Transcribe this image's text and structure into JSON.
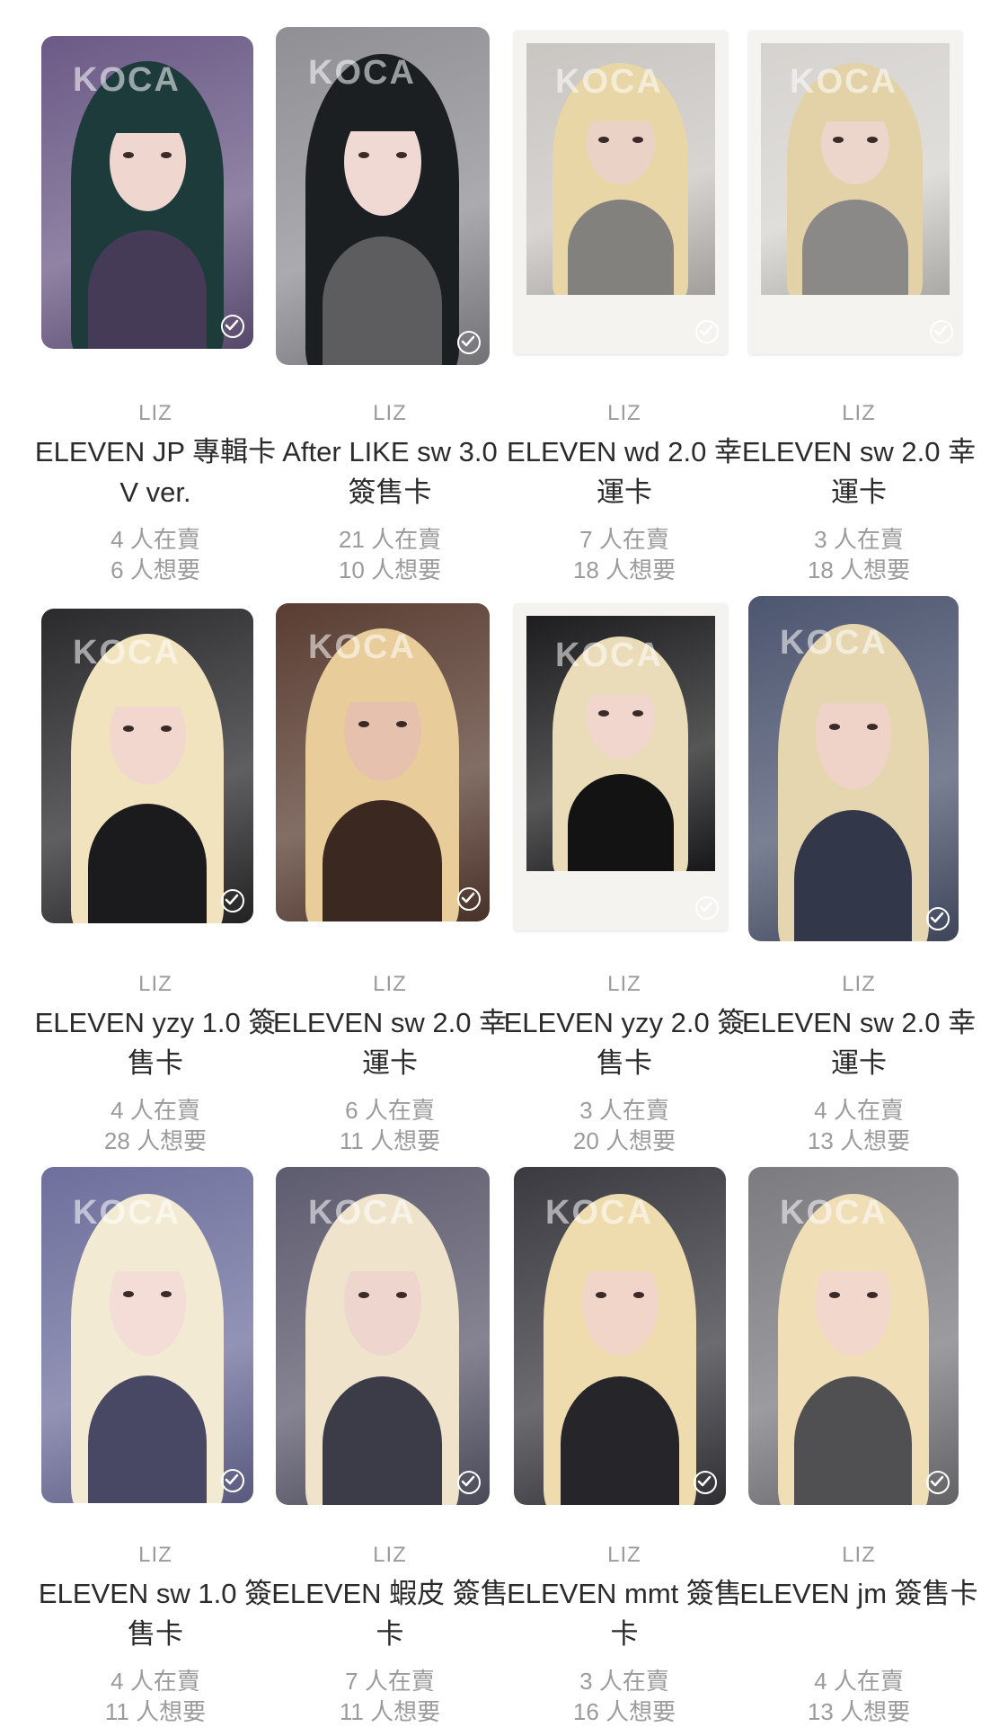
{
  "colors": {
    "background": "#ffffff",
    "title_text": "#2b2b2b",
    "meta_text": "#9b9b9b"
  },
  "cards": [
    {
      "member": "LIZ",
      "title": "ELEVEN JP 專輯卡 V ver.",
      "sellers": "4 人在賣",
      "wanted": "6 人想要",
      "style": "photo",
      "bg": "#6b5a86",
      "hair": "#1e3b3c",
      "skin": "#efd6cf",
      "check_icon": "check-circle-icon"
    },
    {
      "member": "LIZ",
      "title": "After LIKE sw 3.0 簽售卡",
      "sellers": "21 人在賣",
      "wanted": "10 人想要",
      "style": "photo",
      "bg": "#8f8f94",
      "hair": "#1b1f22",
      "skin": "#f0d9d3",
      "check_icon": "check-circle-icon"
    },
    {
      "member": "LIZ",
      "title": "ELEVEN wd 2.0 幸運卡",
      "sellers": "7 人在賣",
      "wanted": "18 人想要",
      "style": "polaroid",
      "bg": "#c9c6c2",
      "hair": "#e8d6a6",
      "skin": "#ead2c6",
      "check_icon": "check-circle-icon"
    },
    {
      "member": "LIZ",
      "title": "ELEVEN sw 2.0 幸運卡",
      "sellers": "3 人在賣",
      "wanted": "18 人想要",
      "style": "polaroid",
      "bg": "#d6d3cf",
      "hair": "#e3d2a8",
      "skin": "#ecd6cc",
      "check_icon": "check-circle-icon"
    },
    {
      "member": "LIZ",
      "title": "ELEVEN yzy 1.0 簽售卡",
      "sellers": "4 人在賣",
      "wanted": "28 人想要",
      "style": "photo",
      "bg": "#2a2a2c",
      "hair": "#f1e3bd",
      "skin": "#f2d7cf",
      "check_icon": "check-circle-icon"
    },
    {
      "member": "LIZ",
      "title": "ELEVEN sw 2.0 幸運卡",
      "sellers": "6 人在賣",
      "wanted": "11 人想要",
      "style": "photo",
      "bg": "#5a3d32",
      "hair": "#e8cd9a",
      "skin": "#e6c2ae",
      "check_icon": "check-circle-icon"
    },
    {
      "member": "LIZ",
      "title": "ELEVEN yzy 2.0 簽售卡",
      "sellers": "3 人在賣",
      "wanted": "20 人想要",
      "style": "polaroid",
      "bg": "#1d1d1f",
      "hair": "#eadcb8",
      "skin": "#f0d6cc",
      "check_icon": "check-circle-icon"
    },
    {
      "member": "LIZ",
      "title": "ELEVEN sw 2.0 幸運卡",
      "sellers": "4 人在賣",
      "wanted": "13 人想要",
      "style": "photo",
      "bg": "#4d5670",
      "hair": "#e6d6b0",
      "skin": "#efd3c8",
      "check_icon": "check-circle-icon"
    },
    {
      "member": "LIZ",
      "title": "ELEVEN sw 1.0 簽售卡",
      "sellers": "4 人在賣",
      "wanted": "11 人想要",
      "style": "photo",
      "bg": "#6e6f9c",
      "hair": "#f2ead2",
      "skin": "#f3ddd6",
      "check_icon": "check-circle-icon"
    },
    {
      "member": "LIZ",
      "title": "ELEVEN 蝦皮 簽售卡",
      "sellers": "7 人在賣",
      "wanted": "11 人想要",
      "style": "photo",
      "bg": "#5d5b6e",
      "hair": "#efe3cc",
      "skin": "#eed6cf",
      "check_icon": "check-circle-icon"
    },
    {
      "member": "LIZ",
      "title": "ELEVEN mmt 簽售卡",
      "sellers": "3 人在賣",
      "wanted": "16 人想要",
      "style": "photo",
      "bg": "#3a3a40",
      "hair": "#efdcae",
      "skin": "#f1d5c9",
      "check_icon": "check-circle-icon"
    },
    {
      "member": "LIZ",
      "title": "ELEVEN jm 簽售卡",
      "sellers": "4 人在賣",
      "wanted": "13 人想要",
      "style": "photo",
      "bg": "#7b7b80",
      "hair": "#f0deb6",
      "skin": "#f2d7cd",
      "check_icon": "check-circle-icon"
    }
  ],
  "watermark": "KOCA"
}
